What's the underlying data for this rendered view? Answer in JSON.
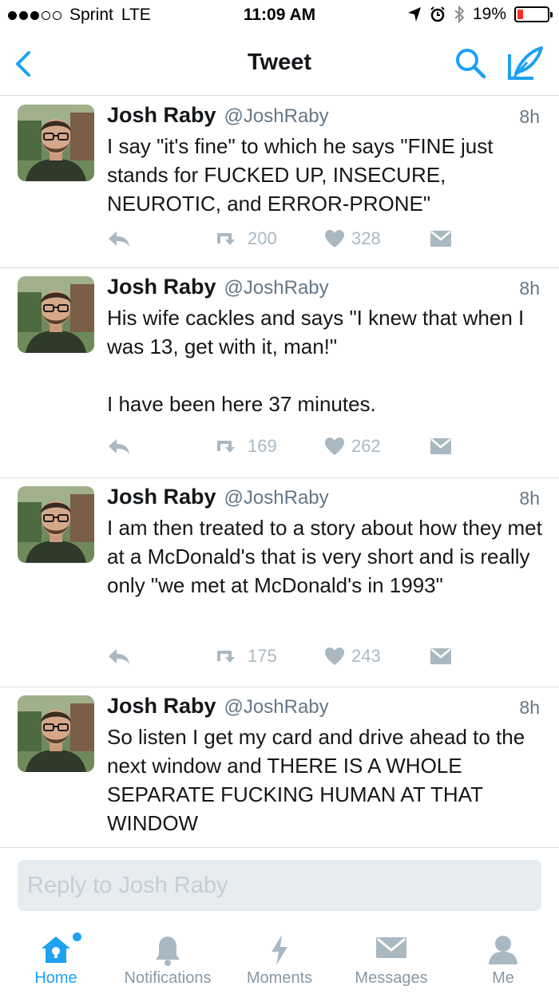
{
  "status_bar": {
    "carrier": "Sprint",
    "network": "LTE",
    "time": "11:09 AM",
    "battery": "19%",
    "battery_level": 0.19,
    "icons": [
      "location-icon",
      "alarm-icon",
      "bluetooth-icon",
      "battery-icon"
    ]
  },
  "nav": {
    "title": "Tweet",
    "icons": [
      "back-icon",
      "search-icon",
      "compose-icon"
    ]
  },
  "tweets": [
    {
      "name": "Josh Raby",
      "handle": "@JoshRaby",
      "time": "8h",
      "text": "I say \"it's fine\" to which he says \"FINE just stands for FUCKED UP, INSECURE, NEUROTIC, and ERROR-PRONE\"",
      "retweets": "200",
      "likes": "328"
    },
    {
      "name": "Josh Raby",
      "handle": "@JoshRaby",
      "time": "8h",
      "text": "His wife cackles and says \"I knew that when I was 13, get with it, man!\"\n\nI have been here 37 minutes.",
      "retweets": "169",
      "likes": "262"
    },
    {
      "name": "Josh Raby",
      "handle": "@JoshRaby",
      "time": "8h",
      "text": "I am then treated to a story about how they met at a McDonald's that is very short and is really only \"we met at McDonald's in 1993\"",
      "retweets": "175",
      "likes": "243"
    },
    {
      "name": "Josh Raby",
      "handle": "@JoshRaby",
      "time": "8h",
      "text": "So listen I get my card and drive ahead to the next window and THERE IS A WHOLE SEPARATE FUCKING HUMAN AT THAT WINDOW",
      "retweets": "",
      "likes": ""
    }
  ],
  "reply": {
    "placeholder": "Reply to Josh Raby"
  },
  "tabs": [
    {
      "label": "Home",
      "icon": "home-icon",
      "active": true
    },
    {
      "label": "Notifications",
      "icon": "bell-icon",
      "active": false
    },
    {
      "label": "Moments",
      "icon": "lightning-icon",
      "active": false
    },
    {
      "label": "Messages",
      "icon": "envelope-icon",
      "active": false
    },
    {
      "label": "Me",
      "icon": "person-icon",
      "active": false
    }
  ],
  "colors": {
    "accent": "#1da1f2",
    "muted": "#aab8c2",
    "secondary_text": "#657786",
    "tab_inactive": "#8899a6",
    "battery_low": "#ff2d20"
  }
}
